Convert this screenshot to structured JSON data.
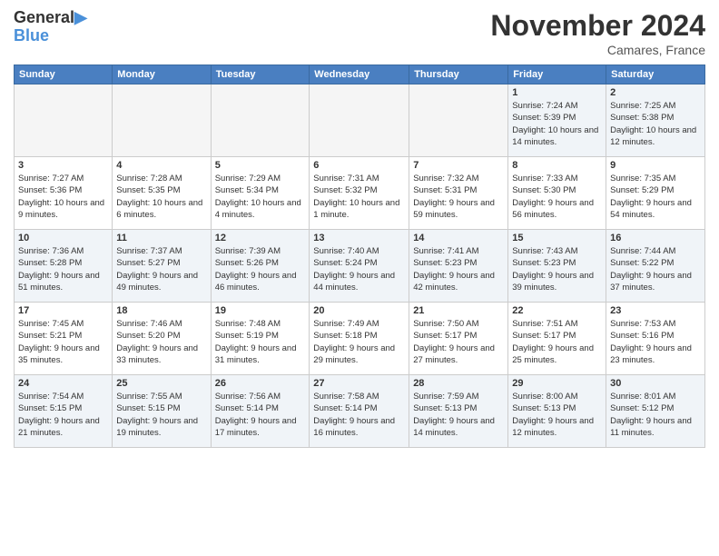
{
  "header": {
    "logo_text1": "General",
    "logo_text2": "Blue",
    "month": "November 2024",
    "location": "Camares, France"
  },
  "weekdays": [
    "Sunday",
    "Monday",
    "Tuesday",
    "Wednesday",
    "Thursday",
    "Friday",
    "Saturday"
  ],
  "weeks": [
    [
      {
        "day": "",
        "info": ""
      },
      {
        "day": "",
        "info": ""
      },
      {
        "day": "",
        "info": ""
      },
      {
        "day": "",
        "info": ""
      },
      {
        "day": "",
        "info": ""
      },
      {
        "day": "1",
        "info": "Sunrise: 7:24 AM\nSunset: 5:39 PM\nDaylight: 10 hours and 14 minutes."
      },
      {
        "day": "2",
        "info": "Sunrise: 7:25 AM\nSunset: 5:38 PM\nDaylight: 10 hours and 12 minutes."
      }
    ],
    [
      {
        "day": "3",
        "info": "Sunrise: 7:27 AM\nSunset: 5:36 PM\nDaylight: 10 hours and 9 minutes."
      },
      {
        "day": "4",
        "info": "Sunrise: 7:28 AM\nSunset: 5:35 PM\nDaylight: 10 hours and 6 minutes."
      },
      {
        "day": "5",
        "info": "Sunrise: 7:29 AM\nSunset: 5:34 PM\nDaylight: 10 hours and 4 minutes."
      },
      {
        "day": "6",
        "info": "Sunrise: 7:31 AM\nSunset: 5:32 PM\nDaylight: 10 hours and 1 minute."
      },
      {
        "day": "7",
        "info": "Sunrise: 7:32 AM\nSunset: 5:31 PM\nDaylight: 9 hours and 59 minutes."
      },
      {
        "day": "8",
        "info": "Sunrise: 7:33 AM\nSunset: 5:30 PM\nDaylight: 9 hours and 56 minutes."
      },
      {
        "day": "9",
        "info": "Sunrise: 7:35 AM\nSunset: 5:29 PM\nDaylight: 9 hours and 54 minutes."
      }
    ],
    [
      {
        "day": "10",
        "info": "Sunrise: 7:36 AM\nSunset: 5:28 PM\nDaylight: 9 hours and 51 minutes."
      },
      {
        "day": "11",
        "info": "Sunrise: 7:37 AM\nSunset: 5:27 PM\nDaylight: 9 hours and 49 minutes."
      },
      {
        "day": "12",
        "info": "Sunrise: 7:39 AM\nSunset: 5:26 PM\nDaylight: 9 hours and 46 minutes."
      },
      {
        "day": "13",
        "info": "Sunrise: 7:40 AM\nSunset: 5:24 PM\nDaylight: 9 hours and 44 minutes."
      },
      {
        "day": "14",
        "info": "Sunrise: 7:41 AM\nSunset: 5:23 PM\nDaylight: 9 hours and 42 minutes."
      },
      {
        "day": "15",
        "info": "Sunrise: 7:43 AM\nSunset: 5:23 PM\nDaylight: 9 hours and 39 minutes."
      },
      {
        "day": "16",
        "info": "Sunrise: 7:44 AM\nSunset: 5:22 PM\nDaylight: 9 hours and 37 minutes."
      }
    ],
    [
      {
        "day": "17",
        "info": "Sunrise: 7:45 AM\nSunset: 5:21 PM\nDaylight: 9 hours and 35 minutes."
      },
      {
        "day": "18",
        "info": "Sunrise: 7:46 AM\nSunset: 5:20 PM\nDaylight: 9 hours and 33 minutes."
      },
      {
        "day": "19",
        "info": "Sunrise: 7:48 AM\nSunset: 5:19 PM\nDaylight: 9 hours and 31 minutes."
      },
      {
        "day": "20",
        "info": "Sunrise: 7:49 AM\nSunset: 5:18 PM\nDaylight: 9 hours and 29 minutes."
      },
      {
        "day": "21",
        "info": "Sunrise: 7:50 AM\nSunset: 5:17 PM\nDaylight: 9 hours and 27 minutes."
      },
      {
        "day": "22",
        "info": "Sunrise: 7:51 AM\nSunset: 5:17 PM\nDaylight: 9 hours and 25 minutes."
      },
      {
        "day": "23",
        "info": "Sunrise: 7:53 AM\nSunset: 5:16 PM\nDaylight: 9 hours and 23 minutes."
      }
    ],
    [
      {
        "day": "24",
        "info": "Sunrise: 7:54 AM\nSunset: 5:15 PM\nDaylight: 9 hours and 21 minutes."
      },
      {
        "day": "25",
        "info": "Sunrise: 7:55 AM\nSunset: 5:15 PM\nDaylight: 9 hours and 19 minutes."
      },
      {
        "day": "26",
        "info": "Sunrise: 7:56 AM\nSunset: 5:14 PM\nDaylight: 9 hours and 17 minutes."
      },
      {
        "day": "27",
        "info": "Sunrise: 7:58 AM\nSunset: 5:14 PM\nDaylight: 9 hours and 16 minutes."
      },
      {
        "day": "28",
        "info": "Sunrise: 7:59 AM\nSunset: 5:13 PM\nDaylight: 9 hours and 14 minutes."
      },
      {
        "day": "29",
        "info": "Sunrise: 8:00 AM\nSunset: 5:13 PM\nDaylight: 9 hours and 12 minutes."
      },
      {
        "day": "30",
        "info": "Sunrise: 8:01 AM\nSunset: 5:12 PM\nDaylight: 9 hours and 11 minutes."
      }
    ]
  ]
}
